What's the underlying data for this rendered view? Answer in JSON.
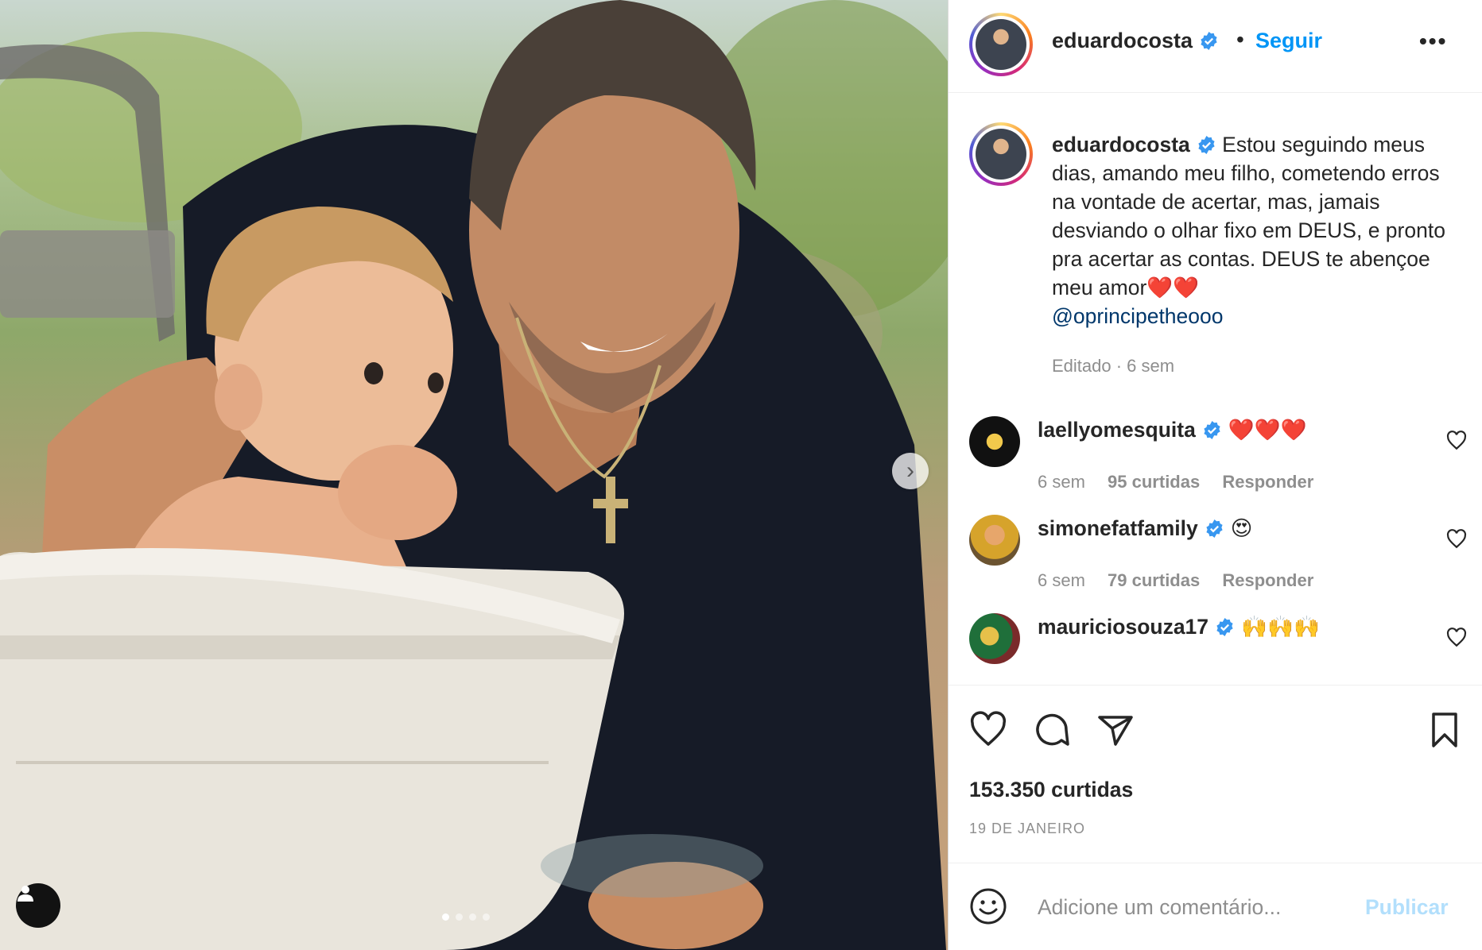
{
  "post": {
    "username": "eduardocosta",
    "follow_label": "Seguir",
    "separator": "•",
    "more_label": "•••"
  },
  "caption": {
    "username": "eduardocosta",
    "text": "Estou seguindo meus dias, amando meu filho, cometendo erros na vontade de acertar, mas, jamais desviando o olhar fixo em DEUS, e pronto pra acertar as contas. DEUS te abençoe meu amor❤️❤️",
    "mention": "@oprincipetheooo",
    "meta": "Editado · 6 sem"
  },
  "comments": [
    {
      "username": "laellyomesquita",
      "text": "❤️❤️❤️",
      "time": "6 sem",
      "likes": "95 curtidas",
      "reply": "Responder"
    },
    {
      "username": "simonefatfamily",
      "text": "😍",
      "time": "6 sem",
      "likes": "79 curtidas",
      "reply": "Responder"
    },
    {
      "username": "mauriciosouza17",
      "text": "🙌🙌🙌",
      "time": "",
      "likes": "",
      "reply": ""
    }
  ],
  "stats": {
    "likes": "153.350 curtidas",
    "date": "19 DE JANEIRO"
  },
  "add_comment": {
    "placeholder": "Adicione um comentário...",
    "publish_label": "Publicar"
  },
  "carousel": {
    "count": 4,
    "active": 1
  },
  "icons": {
    "verified": "verified-badge-icon",
    "like": "heart-icon",
    "comment": "comment-icon",
    "share": "paper-plane-icon",
    "save": "bookmark-icon",
    "next": "chevron-right-icon",
    "tag": "user-tag-icon",
    "emoji": "smiley-icon"
  },
  "colors": {
    "accent": "#0095f6",
    "publish_disabled": "#b2dffc",
    "heart_red": "#ed4956",
    "mention": "#00376b",
    "muted": "#8e8e8e"
  }
}
